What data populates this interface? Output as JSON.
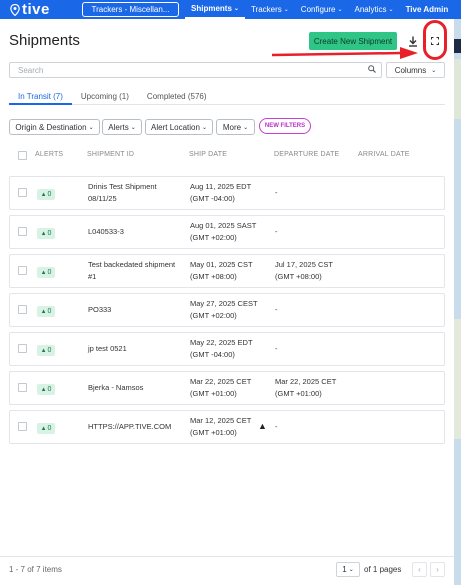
{
  "nav": {
    "brand": "tive",
    "tracker_selector": "Trackers - Miscellan...",
    "items": [
      {
        "label": "Shipments",
        "active": true
      },
      {
        "label": "Trackers"
      },
      {
        "label": "Configure"
      },
      {
        "label": "Analytics"
      },
      {
        "label": "Tive Admin"
      }
    ]
  },
  "header": {
    "title": "Shipments",
    "create_label": "Create New Shipment",
    "download_icon": "download-icon",
    "expand_icon": "expand-icon"
  },
  "search": {
    "placeholder": "Search"
  },
  "columns_label": "Columns",
  "tabs": [
    {
      "label": "In Transit (7)",
      "active": true
    },
    {
      "label": "Upcoming (1)"
    },
    {
      "label": "Completed (576)"
    }
  ],
  "filters": [
    "Origin & Destination",
    "Alerts",
    "Alert Location",
    "More"
  ],
  "new_filters_label": "NEW FILTERS",
  "table": {
    "headers": [
      "ALERTS",
      "SHIPMENT ID",
      "SHIP DATE",
      "DEPARTURE DATE",
      "ARRIVAL DATE"
    ],
    "rows": [
      {
        "alerts": "0",
        "id": [
          "Drinis Test Shipment",
          "08/11/25"
        ],
        "ship": [
          "Aug 11, 2025 EDT",
          "(GMT -04:00)"
        ],
        "departure": [
          "-"
        ],
        "arrival": "",
        "warning": false
      },
      {
        "alerts": "0",
        "id": [
          "L040533-3"
        ],
        "ship": [
          "Aug 01, 2025 SAST",
          "(GMT +02:00)"
        ],
        "departure": [
          "-"
        ],
        "arrival": "",
        "warning": false
      },
      {
        "alerts": "0",
        "id": [
          "Test backedated shipment",
          "#1"
        ],
        "ship": [
          "May 01, 2025 CST",
          "(GMT +08:00)"
        ],
        "departure": [
          "Jul 17, 2025 CST",
          "(GMT +08:00)"
        ],
        "arrival": "",
        "warning": false
      },
      {
        "alerts": "0",
        "id": [
          "PO333"
        ],
        "ship": [
          "May 27, 2025 CEST",
          "(GMT +02:00)"
        ],
        "departure": [
          "-"
        ],
        "arrival": "",
        "warning": false
      },
      {
        "alerts": "0",
        "id": [
          "jp test 0521"
        ],
        "ship": [
          "May 22, 2025 EDT",
          "(GMT -04:00)"
        ],
        "departure": [
          "-"
        ],
        "arrival": "",
        "warning": false
      },
      {
        "alerts": "0",
        "id": [
          "Bjerka - Namsos"
        ],
        "ship": [
          "Mar 22, 2025 CET",
          "(GMT +01:00)"
        ],
        "departure": [
          "Mar 22, 2025 CET",
          "(GMT +01:00)"
        ],
        "arrival": "",
        "warning": false
      },
      {
        "alerts": "0",
        "id": [
          "HTTPS://APP.TIVE.COM"
        ],
        "ship": [
          "Mar 12, 2025 CET",
          "(GMT +01:00)"
        ],
        "departure": [
          "-"
        ],
        "arrival": "",
        "warning": true
      }
    ]
  },
  "footer": {
    "count": "1 - 7 of 7 items",
    "page": "1",
    "page_of": "of 1 pages"
  },
  "colors": {
    "nav": "#1a67e8",
    "primary_button": "#2fc586",
    "annotation": "#e8202a",
    "new_filters": "#c83fd6"
  }
}
